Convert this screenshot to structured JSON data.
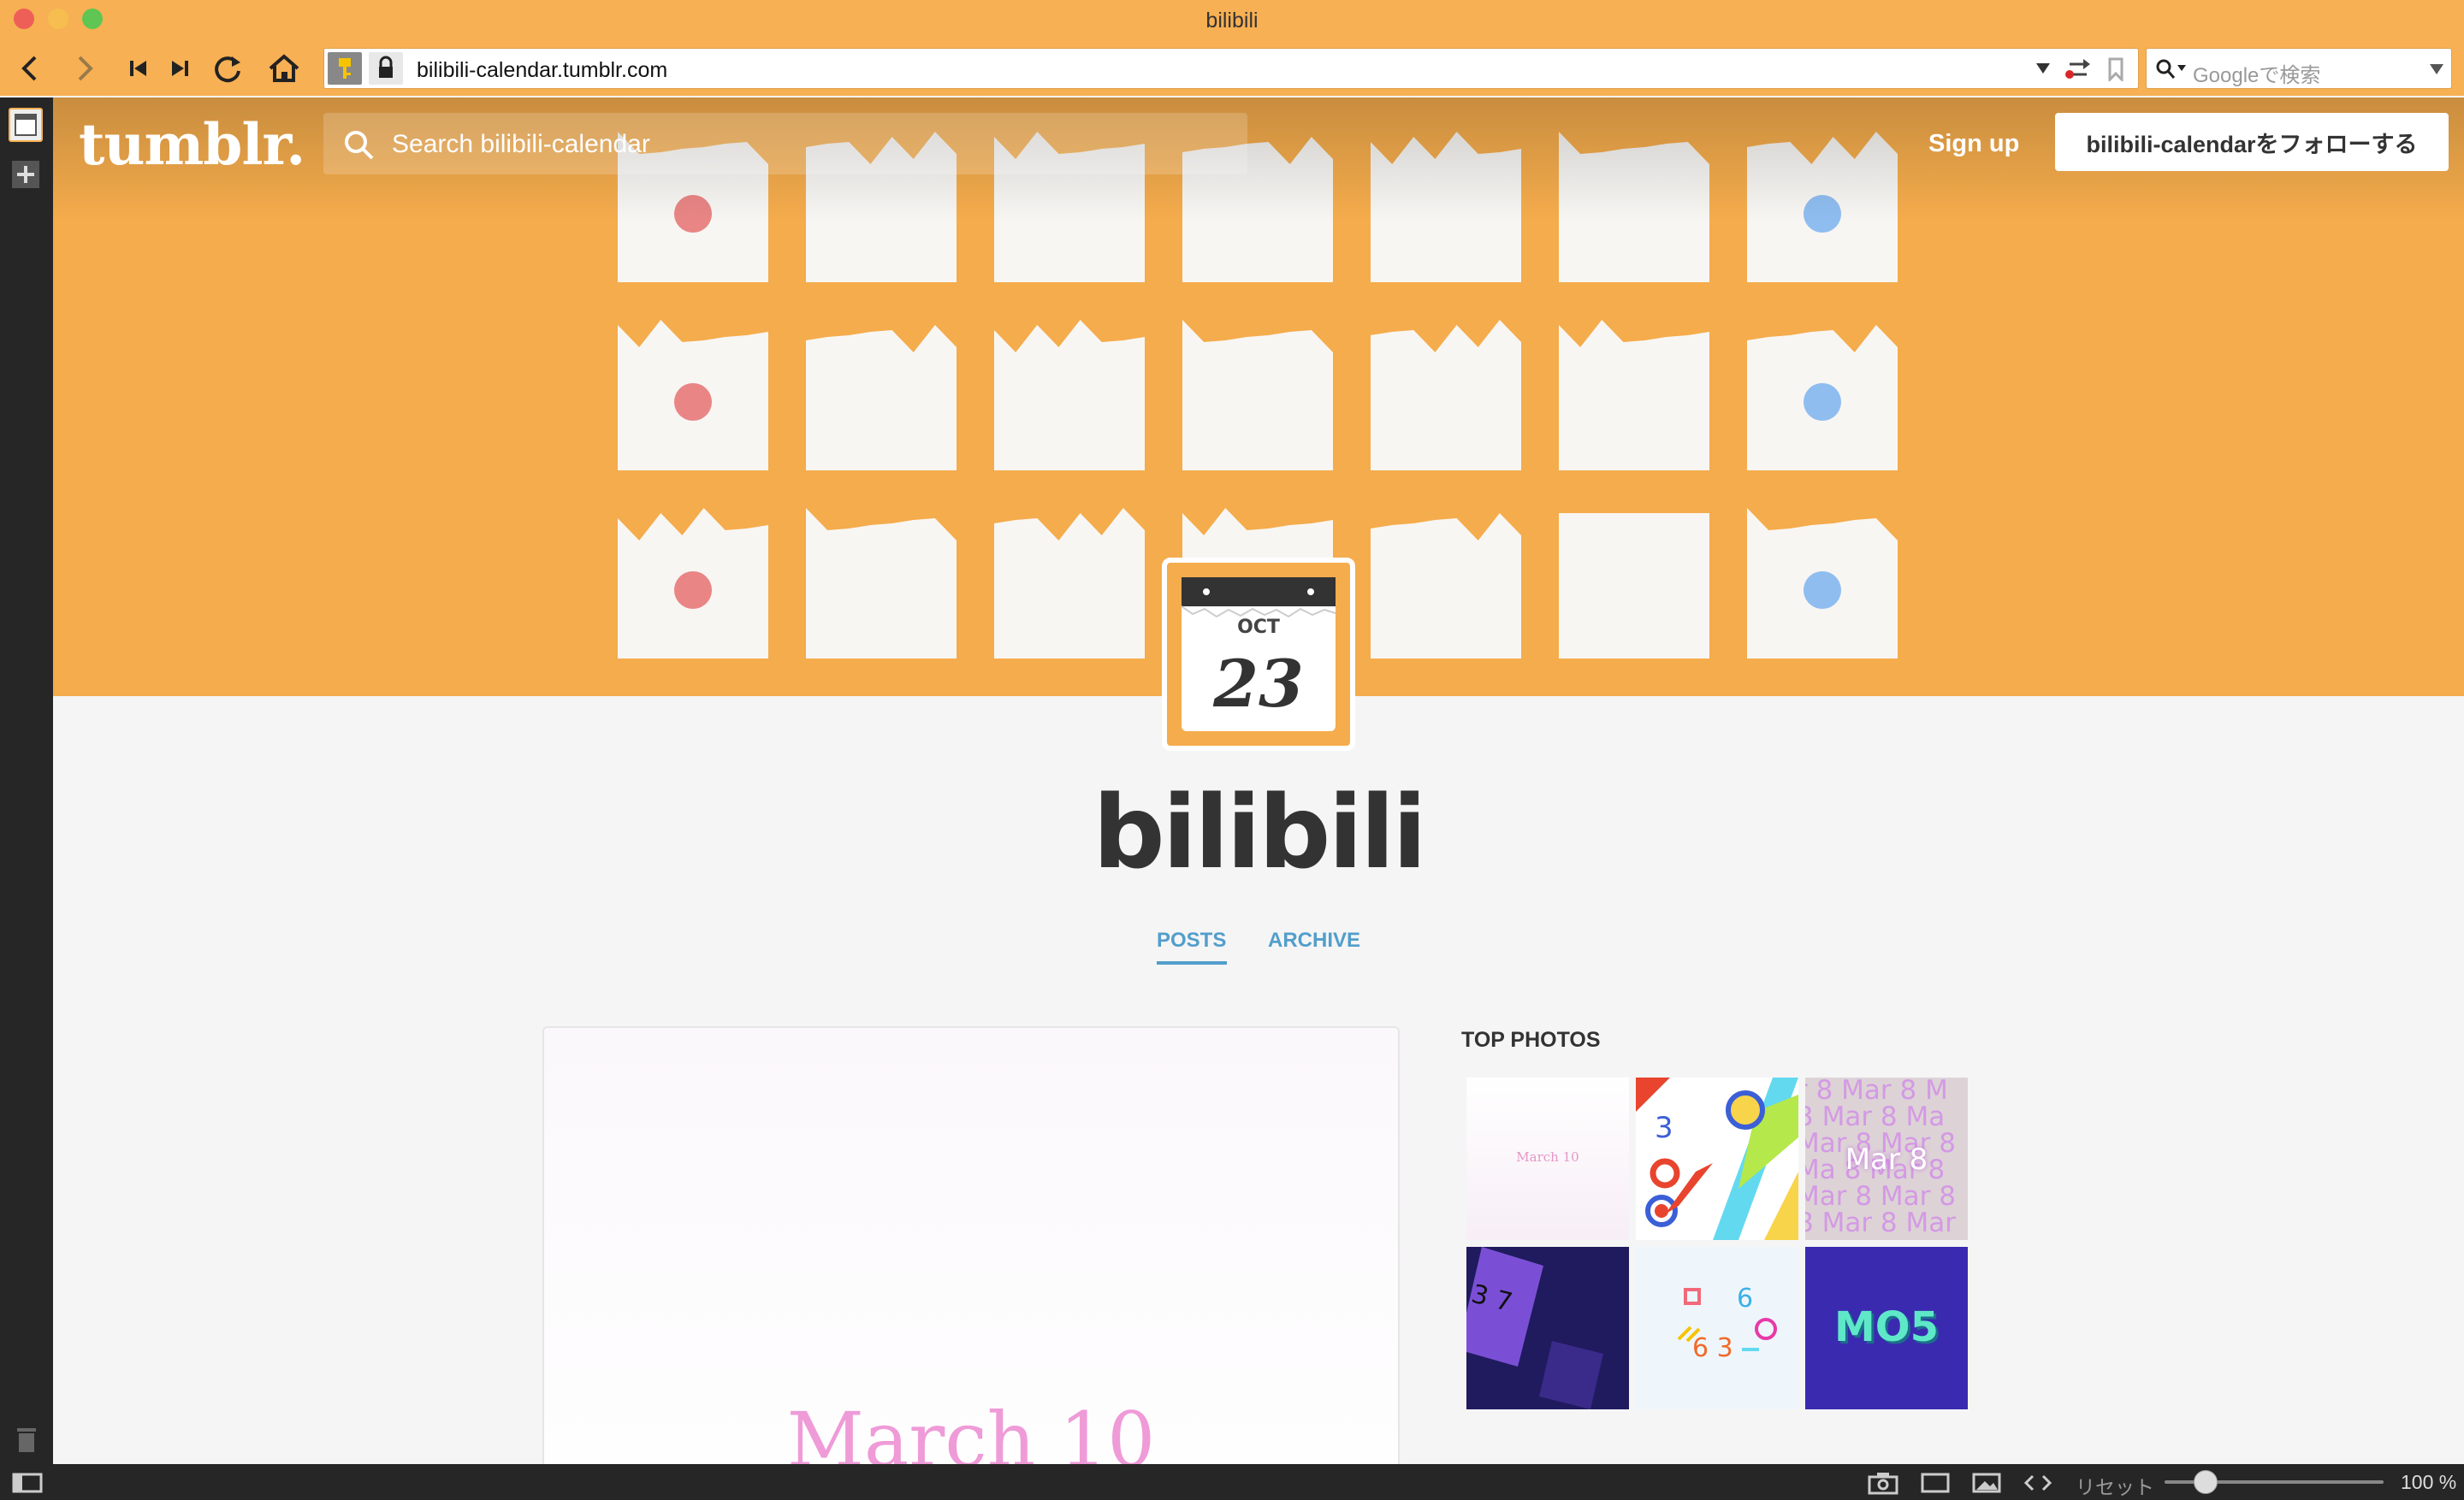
{
  "window": {
    "title": "bilibili"
  },
  "browser": {
    "url": "bilibili-calendar.tumblr.com",
    "search_placeholder": "Googleで検索"
  },
  "blog": {
    "logo": "tumblr.",
    "search_placeholder": "Search bilibili-calendar",
    "signup_label": "Sign up",
    "follow_label": "bilibili-calendarをフォローする",
    "title": "bilibili",
    "avatar_month": "OCT",
    "avatar_day": "23",
    "tabs": [
      "POSTS",
      "ARCHIVE"
    ]
  },
  "post": {
    "text": "March 10"
  },
  "top_photos": {
    "title": "TOP PHOTOS",
    "captions": [
      "March 10",
      "3",
      "Mar 8",
      "3 7",
      "6 3",
      "MO5"
    ]
  },
  "statusbar": {
    "reset_label": "リセット",
    "zoom": "100 %"
  },
  "icons": [
    "back-icon",
    "forward-icon",
    "rewind-icon",
    "fast-forward-icon",
    "reload-icon",
    "home-icon",
    "key-icon",
    "lock-icon",
    "search-icon",
    "trash-icon",
    "plus-icon",
    "camera-icon",
    "window-icon",
    "image-icon",
    "code-icon"
  ],
  "colors": {
    "chrome": "#f7b053",
    "banner": "#f5ac4c",
    "accent": "#529ecc",
    "dot_red": "#e98585",
    "dot_blue": "#8fbdf0"
  }
}
